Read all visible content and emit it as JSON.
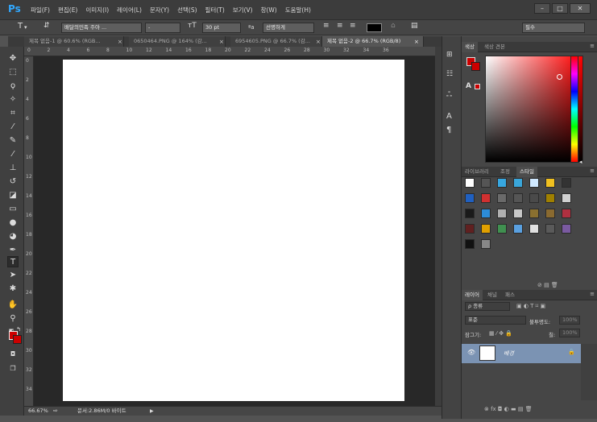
{
  "app": {
    "logo": "Ps"
  },
  "menu": [
    "파일(F)",
    "편집(E)",
    "이미지(I)",
    "레이어(L)",
    "문자(Y)",
    "선택(S)",
    "필터(T)",
    "보기(V)",
    "창(W)",
    "도움말(H)"
  ],
  "window_controls": {
    "minimize": "–",
    "maximize": "□",
    "close": "✕"
  },
  "options": {
    "font_family": "배달의민족 주아 ...",
    "font_style": "-",
    "font_size": "30 pt",
    "aa_label": "ªa",
    "antialias": "선명하게",
    "workspace": "필수"
  },
  "tabs": [
    {
      "label": "제목 없음-1 @ 60.6% (RGB...",
      "close": "×"
    },
    {
      "label": "0650464.PNG @ 164% (감...",
      "close": "×"
    },
    {
      "label": "6954605.PNG @ 66.7% (감...",
      "close": "×"
    },
    {
      "label": "제목 없음-2 @ 66.7% (RGB/8)",
      "close": "×",
      "active": true
    }
  ],
  "ruler_top": [
    "0",
    "2",
    "4",
    "6",
    "8",
    "10",
    "12",
    "14",
    "16",
    "18",
    "20",
    "22",
    "24",
    "26",
    "28",
    "30",
    "32",
    "34",
    "36"
  ],
  "ruler_left": [
    "0",
    "2",
    "4",
    "6",
    "8",
    "10",
    "12",
    "14",
    "16",
    "18",
    "20",
    "22",
    "24",
    "26",
    "28",
    "30",
    "32",
    "34"
  ],
  "status": {
    "zoom": "66.67%",
    "doc_info": "문서:2.86M/0 바이트"
  },
  "panels": {
    "color_tabs": [
      "색상",
      "색상 견본"
    ],
    "color_a_label": "A",
    "styles_tabs": [
      "라이브러리",
      "조정",
      "스타일"
    ],
    "layers_tabs": [
      "레이어",
      "채널",
      "패스"
    ],
    "layer_filter": "ρ 종류",
    "blend_mode": "표준",
    "opacity_label": "불투명도:",
    "opacity_value": "100%",
    "lock_label": "잠그기:",
    "fill_label": "칠:",
    "fill_value": "100%",
    "layer_name": "배경"
  },
  "colors": {
    "foreground": "#cc0000",
    "background": "#cc0000",
    "canvas": "#ffffff",
    "selected_layer": "#7b93b3"
  }
}
